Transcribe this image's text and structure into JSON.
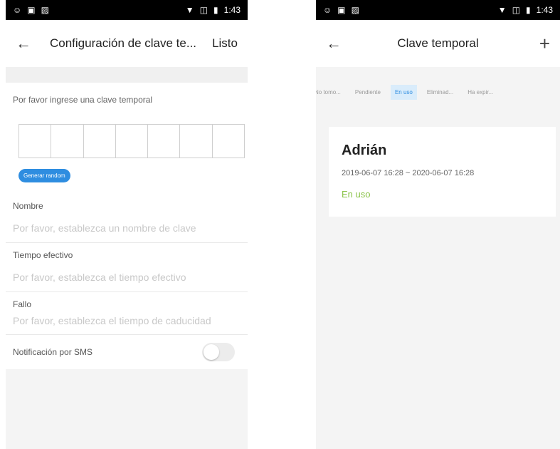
{
  "left": {
    "status": {
      "time": "1:43"
    },
    "nav": {
      "back_icon": "arrow-left-icon",
      "title": "Configuración de clave te...",
      "done": "Listo"
    },
    "prompt": "Por favor ingrese una clave temporal",
    "code_boxes": 7,
    "generate_label": "Generar random",
    "fields": [
      {
        "label": "Nombre",
        "placeholder": "Por favor, establezca un nombre de clave"
      },
      {
        "label": "Tiempo efectivo",
        "placeholder": "Por favor, establezca el tiempo efectivo"
      },
      {
        "label": "Fallo",
        "placeholder": "Por favor, establezca el tiempo de caducidad"
      }
    ],
    "sms": {
      "label": "Notificación por SMS",
      "on": false
    }
  },
  "right": {
    "status": {
      "time": "1:43"
    },
    "nav": {
      "back_icon": "arrow-left-icon",
      "title": "Clave temporal",
      "add_icon": "plus-icon"
    },
    "tabs": [
      {
        "label": "No tomo...",
        "active": false
      },
      {
        "label": "Pendiente",
        "active": false
      },
      {
        "label": "En uso",
        "active": true
      },
      {
        "label": "Eliminad...",
        "active": false
      },
      {
        "label": "Ha expir...",
        "active": false
      }
    ],
    "card": {
      "name": "Adrián",
      "range": "2019-06-07 16:28 ~ 2020-06-07 16:28",
      "status": "En uso"
    }
  },
  "colors": {
    "accent": "#2e8de0",
    "status_green": "#8bc34a"
  }
}
